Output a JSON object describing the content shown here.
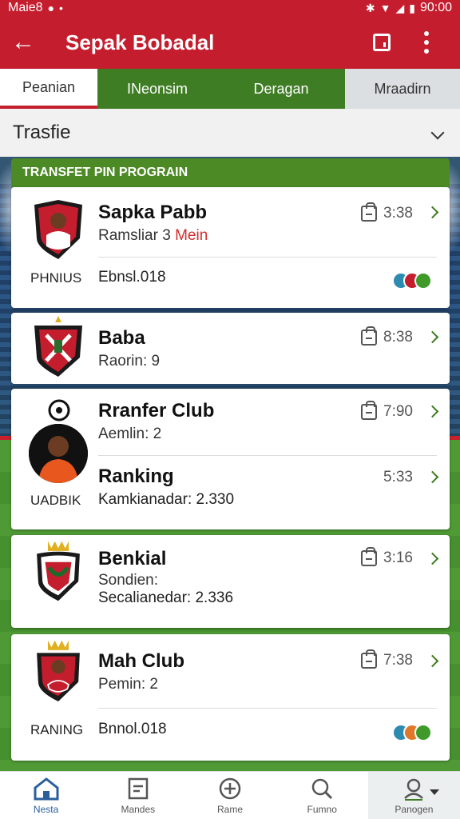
{
  "status_bar": {
    "carrier": "Maie8",
    "time": "90:00"
  },
  "app_bar": {
    "title": "Sepak Bobadal"
  },
  "tabs": [
    {
      "label": "Peanian"
    },
    {
      "label": "INeonsim"
    },
    {
      "label": "Deragan"
    },
    {
      "label": "Mraadirn"
    }
  ],
  "section": {
    "title": "Trasfie"
  },
  "banner": {
    "label": "TRANSFET PIN PROGRAIN"
  },
  "cards": [
    {
      "name": "Sapka Pabb",
      "sub": "Ramsliar 3",
      "sub_accent": "Mein",
      "time": "3:38",
      "caption": "PHNIUS",
      "caption2": "Ebnsl.018"
    },
    {
      "name": "Baba",
      "sub": "Raorin: 9",
      "time": "8:38"
    },
    {
      "name": "Rranfer Club",
      "sub": "Aemlin: 2",
      "time": "7:90",
      "name2": "Ranking",
      "time2": "5:33",
      "caption": "UADBIK",
      "caption2": "Kamkianadar: 2.330"
    },
    {
      "name": "Benkial",
      "sub": "Sondien:",
      "time": "3:16",
      "caption2": "Secalianedar: 2.336"
    },
    {
      "name": "Mah Club",
      "sub": "Pemin: 2",
      "time": "7:38",
      "caption": "RANING",
      "caption2": "Bnnol.018"
    }
  ],
  "bottom_nav": [
    {
      "label": "Nesta",
      "icon": "home-icon"
    },
    {
      "label": "Mandes",
      "icon": "clipboard-icon"
    },
    {
      "label": "Rame",
      "icon": "plus-circle-icon"
    },
    {
      "label": "Fumno",
      "icon": "search-icon"
    },
    {
      "label": "Panogen",
      "icon": "user-icon"
    }
  ],
  "colors": {
    "brand": "#c41d2e",
    "accent_green": "#3f7d24",
    "nav_active": "#2a5f9e"
  }
}
